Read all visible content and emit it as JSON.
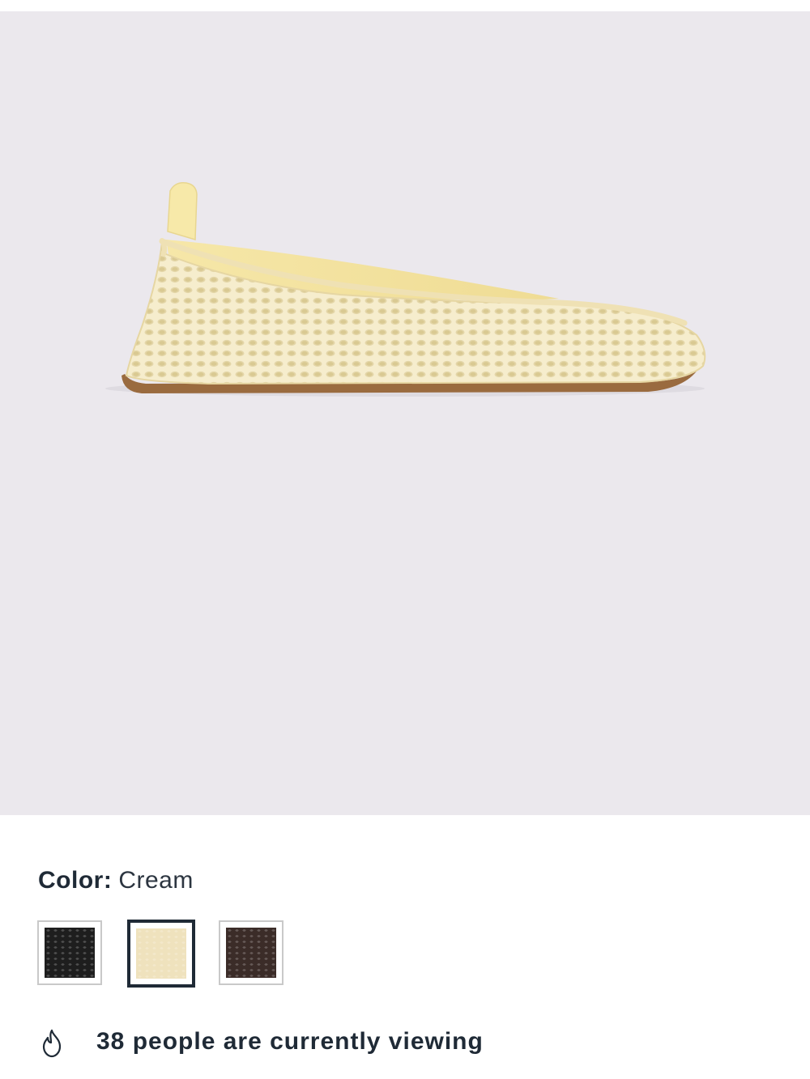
{
  "product": {
    "image_alt": "Cream mesh ballet flat",
    "colors": {
      "hero_background": "#ebe8ed",
      "shoe_mesh": "#f3e9c4",
      "shoe_sole": "#9a6b3f"
    }
  },
  "color_selector": {
    "label": "Color:",
    "selected_value": "Cream",
    "swatches": [
      {
        "name": "Black",
        "color": "#1e1e1e",
        "selected": false
      },
      {
        "name": "Cream",
        "color": "#efe2bd",
        "selected": true
      },
      {
        "name": "Brown",
        "color": "#3b2c28",
        "selected": false
      }
    ]
  },
  "social_proof": {
    "icon": "flame-icon",
    "text": "38 people are currently viewing"
  }
}
